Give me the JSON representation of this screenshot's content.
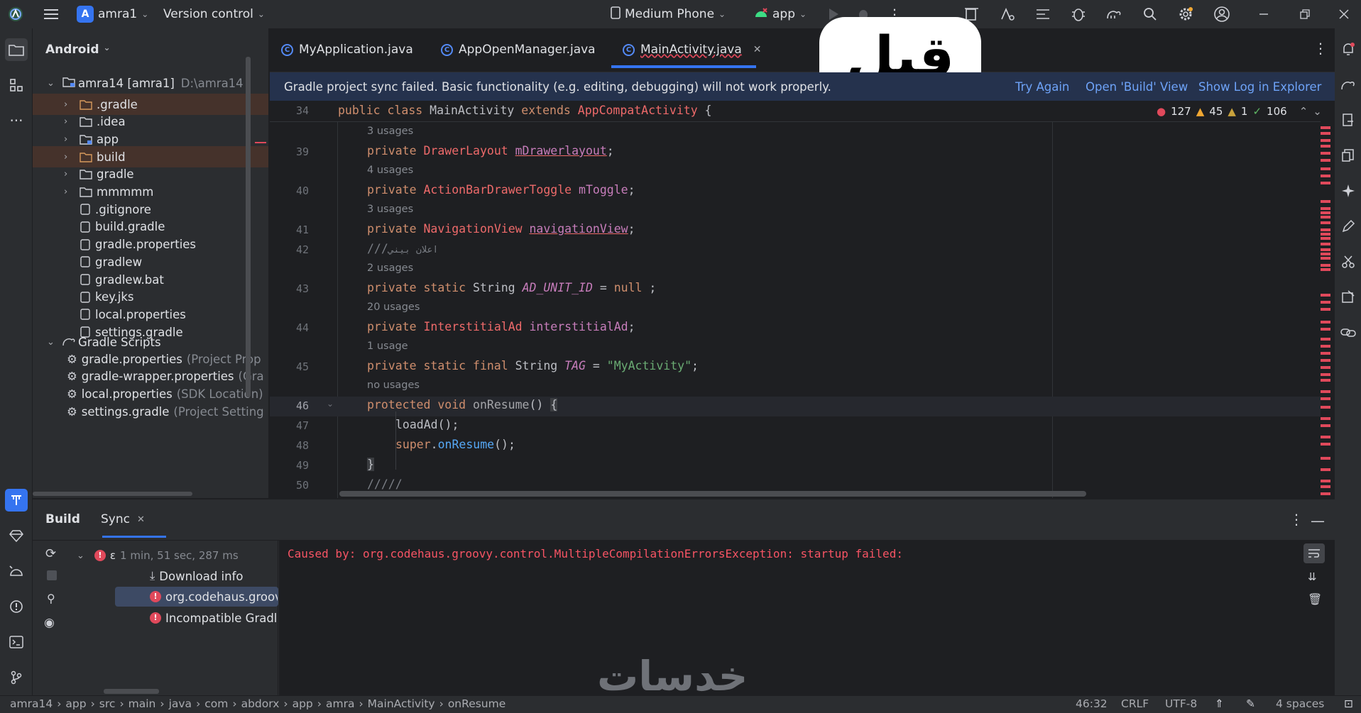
{
  "titlebar": {
    "project_letter": "A",
    "project_name": "amra1",
    "vcs": "Version control",
    "device": "Medium Phone",
    "run_config": "app"
  },
  "sidebar_left": {
    "tool_icons": [
      "folder-icon",
      "structure-icon",
      "more-icon",
      "build-icon",
      "gem-icon",
      "android-icon",
      "problems-icon",
      "terminal-icon",
      "git-icon"
    ]
  },
  "project_panel": {
    "view_name": "Android",
    "root": {
      "name": "amra14 [amra1]",
      "path": "D:\\amra14"
    },
    "items": [
      {
        "name": ".gradle",
        "type": "folder",
        "excluded": true
      },
      {
        "name": ".idea",
        "type": "folder"
      },
      {
        "name": "app",
        "type": "module"
      },
      {
        "name": "build",
        "type": "folder",
        "excluded": true
      },
      {
        "name": "gradle",
        "type": "folder"
      },
      {
        "name": "mmmmm",
        "type": "folder"
      },
      {
        "name": ".gitignore",
        "type": "file"
      },
      {
        "name": "build.gradle",
        "type": "file"
      },
      {
        "name": "gradle.properties",
        "type": "file"
      },
      {
        "name": "gradlew",
        "type": "file"
      },
      {
        "name": "gradlew.bat",
        "type": "file"
      },
      {
        "name": "key.jks",
        "type": "file"
      },
      {
        "name": "local.properties",
        "type": "file"
      },
      {
        "name": "settings.gradle",
        "type": "file"
      }
    ],
    "scripts_label": "Gradle Scripts",
    "scripts": [
      {
        "name": "gradle.properties",
        "hint": "(Project Prop"
      },
      {
        "name": "gradle-wrapper.properties",
        "hint": "(Gra"
      },
      {
        "name": "local.properties",
        "hint": "(SDK Location)"
      },
      {
        "name": "settings.gradle",
        "hint": "(Project Setting"
      }
    ]
  },
  "editor_tabs": [
    {
      "label": "MyApplication.java"
    },
    {
      "label": "AppOpenManager.java"
    },
    {
      "label": "MainActivity.java",
      "active": true
    }
  ],
  "overlay_label": "قبل",
  "notice": {
    "text": "Gradle project sync failed. Basic functionality (e.g. editing, debugging) will not work properly.",
    "try_again": "Try Again",
    "open_build": "Open 'Build' View",
    "show_log": "Show Log in Explorer"
  },
  "inspections": {
    "errors": "127",
    "warnings": "45",
    "weak_warnings": "1",
    "ok": "106"
  },
  "code": {
    "header_line_no": "34",
    "header_text": "public class MainActivity extends AppCompatActivity {",
    "lines": [
      {
        "no": "39",
        "hint": "3 usages",
        "text": "private DrawerLayout mDrawerlayout;"
      },
      {
        "no": "40",
        "hint": "4 usages",
        "text": "private ActionBarDrawerToggle mToggle;"
      },
      {
        "no": "41",
        "hint": "3 usages",
        "text": "private NavigationView navigationView;"
      },
      {
        "no": "42",
        "hint": "",
        "text": "///اعلان بيني"
      },
      {
        "no": "43",
        "hint": "2 usages",
        "text": "private static String AD_UNIT_ID = null ;"
      },
      {
        "no": "44",
        "hint": "20 usages",
        "text": "private InterstitialAd interstitialAd;"
      },
      {
        "no": "45",
        "hint": "1 usage",
        "text": "private static final String TAG = \"MyActivity\";"
      },
      {
        "no": "46",
        "hint": "no usages",
        "text": "protected void onResume() {"
      },
      {
        "no": "47",
        "hint": "",
        "text": "loadAd();"
      },
      {
        "no": "48",
        "hint": "",
        "text": "super.onResume();"
      },
      {
        "no": "49",
        "hint": "",
        "text": "}"
      },
      {
        "no": "50",
        "hint": "",
        "text": "/////"
      }
    ]
  },
  "build_panel": {
    "title": "Build",
    "tab": "Sync",
    "tree": [
      {
        "label": "ε",
        "time": "1 min, 51 sec, 287 ms"
      },
      {
        "label": "Download info"
      },
      {
        "label": "org.codehaus.groov"
      },
      {
        "label": "Incompatible Gradle"
      }
    ],
    "console": "Caused by: org.codehaus.groovy.control.MultipleCompilationErrorsException: startup failed:"
  },
  "watermark": "خدسات",
  "status_bar": {
    "breadcrumb": [
      "amra14",
      "app",
      "src",
      "main",
      "java",
      "com",
      "abdorx",
      "app",
      "amra",
      "MainActivity",
      "onResume"
    ],
    "position": "46:32",
    "line_sep": "CRLF",
    "encoding": "UTF-8",
    "indent": "4 spaces"
  },
  "colors": {
    "accent": "#3574f0",
    "error": "#e0495b",
    "notice_bg": "#25324d"
  }
}
